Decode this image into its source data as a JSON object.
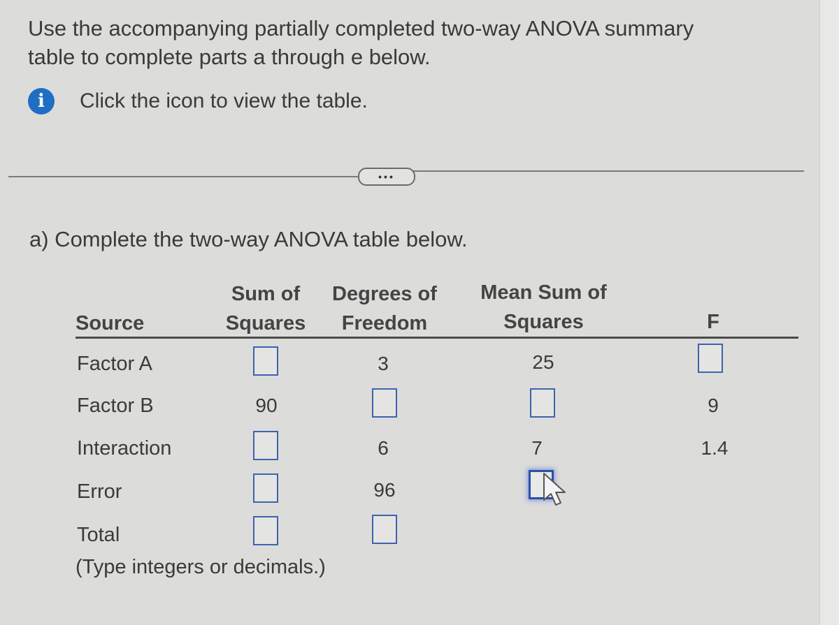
{
  "intro": {
    "line1": "Use the accompanying partially completed two-way ANOVA summary",
    "line2": "table to complete parts a through e below.",
    "info_icon": "info-icon",
    "info_text": "Click the icon to view the table."
  },
  "more_button": {
    "label": "•••",
    "icon": "ellipsis-icon"
  },
  "part_a": {
    "prompt": "a) Complete the two-way ANOVA table below."
  },
  "table": {
    "headers": {
      "source": "Source",
      "ss_line1": "Sum of",
      "ss_line2": "Squares",
      "df_line1": "Degrees of",
      "df_line2": "Freedom",
      "ms_line1": "Mean Sum of",
      "ms_line2": "Squares",
      "f": "F"
    },
    "rows": [
      {
        "source": "Factor A",
        "ss": "",
        "df": "3",
        "ms": "25",
        "f": ""
      },
      {
        "source": "Factor B",
        "ss": "90",
        "df": "",
        "ms": "",
        "f": "9"
      },
      {
        "source": "Interaction",
        "ss": "",
        "df": "6",
        "ms": "7",
        "f": "1.4"
      },
      {
        "source": "Error",
        "ss": "",
        "df": "96",
        "ms": "",
        "f": null
      },
      {
        "source": "Total",
        "ss": "",
        "df": "",
        "ms": null,
        "f": null
      }
    ],
    "note": "(Type integers or decimals.)"
  },
  "colors": {
    "accent": "#1e6ec4",
    "input_border": "#3f62b0",
    "background": "#dcdcda"
  }
}
